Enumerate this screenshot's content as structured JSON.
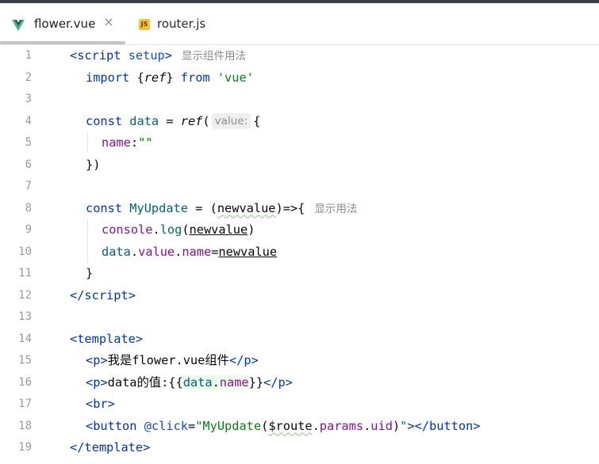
{
  "tabs": [
    {
      "label": "flower.vue",
      "icon": "vue-icon",
      "active": true
    },
    {
      "label": "router.js",
      "icon": "js-icon",
      "icon_text": "JS",
      "active": false
    }
  ],
  "gutter": {
    "line_numbers": [
      "1",
      "2",
      "3",
      "4",
      "5",
      "6",
      "7",
      "8",
      "9",
      "10",
      "11",
      "12",
      "13",
      "14",
      "15",
      "16",
      "17",
      "18",
      "19"
    ]
  },
  "code": {
    "l1": {
      "open": "<",
      "tag": "script",
      "attr": "setup",
      "close": ">",
      "hint": "显示组件用法"
    },
    "l2": {
      "kw": "import",
      "brace_open": "{",
      "name": "ref",
      "brace_close": "}",
      "from": "from",
      "str": "'vue'"
    },
    "l4": {
      "kw": "const",
      "name": "data",
      "eq": " = ",
      "fn": "ref",
      "paren": "(",
      "param_hint": "value:",
      "brace": "{"
    },
    "l5": {
      "prop": "name",
      "colon": ":",
      "str": "\"\""
    },
    "l6": {
      "text": "})"
    },
    "l8": {
      "kw": "const",
      "name": "MyUpdate",
      "eq": " = (",
      "param": "newvalue",
      "arrow": ")=>{",
      "hint": "显示用法"
    },
    "l9": {
      "obj": "console",
      "dot": ".",
      "method": "log",
      "paren_open": "(",
      "arg": "newvalue",
      "paren_close": ")"
    },
    "l10": {
      "obj": "data",
      "dot1": ".",
      "p1": "value",
      "dot2": ".",
      "p2": "name",
      "eq": "=",
      "rhs": "newvalue"
    },
    "l11": {
      "text": "}"
    },
    "l12": {
      "open": "</",
      "tag": "script",
      "close": ">"
    },
    "l14": {
      "open": "<",
      "tag": "template",
      "close": ">"
    },
    "l15": {
      "open": "<",
      "tag": "p",
      "close": ">",
      "text": "我是flower.vue组件",
      "end_open": "</",
      "end_tag": "p",
      "end_close": ">"
    },
    "l16": {
      "open": "<",
      "tag": "p",
      "close": ">",
      "text": "data的值:{{",
      "expr_obj": "data",
      "expr_dot": ".",
      "expr_prop": "name",
      "text_after": "}}",
      "end_open": "</",
      "end_tag": "p",
      "end_close": ">"
    },
    "l17": {
      "open": "<",
      "tag": "br",
      "close": ">"
    },
    "l18": {
      "open": "<",
      "tag": "button",
      "sp": " ",
      "attr": "@click",
      "eq": "=",
      "q1": "\"",
      "fn": "MyUpdate",
      "po": "(",
      "route": "$route",
      "d1": ".",
      "params": "params",
      "d2": ".",
      "uid": "uid",
      "pc": ")",
      "q2": "\"",
      "close": ">",
      "end_open": "</",
      "end_tag": "button",
      "end_close": ">"
    },
    "l19": {
      "open": "</",
      "tag": "template",
      "close": ">"
    }
  },
  "colors": {
    "tag": "#0033b3",
    "string": "#067d17",
    "property": "#871094",
    "identifier": "#00627a",
    "line_number": "#9a9a9a",
    "hint": "#8c8c8c"
  }
}
